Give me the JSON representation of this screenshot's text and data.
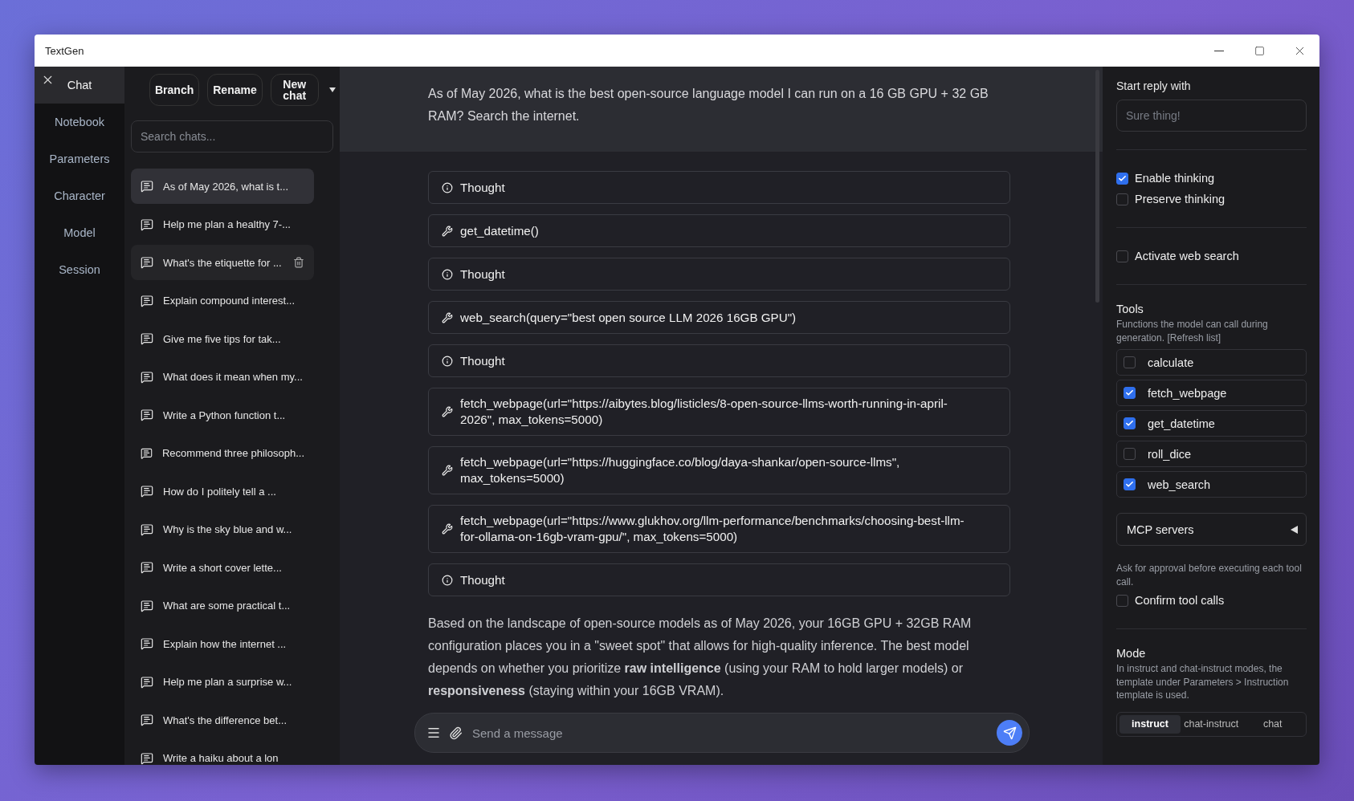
{
  "window": {
    "title": "TextGen"
  },
  "nav": {
    "items": [
      {
        "label": "Chat",
        "selected": true
      },
      {
        "label": "Notebook",
        "selected": false
      },
      {
        "label": "Parameters",
        "selected": false
      },
      {
        "label": "Character",
        "selected": false
      },
      {
        "label": "Model",
        "selected": false
      },
      {
        "label": "Session",
        "selected": false
      }
    ]
  },
  "chat_list": {
    "buttons": [
      "Branch",
      "Rename",
      "New chat"
    ],
    "search": {
      "placeholder": "Search chats..."
    },
    "items": [
      {
        "title": "As of May 2026, what is t...",
        "selected": true,
        "hovered": false
      },
      {
        "title": "Help me plan a healthy 7-...",
        "selected": false,
        "hovered": false
      },
      {
        "title": "What's the etiquette for ...",
        "selected": false,
        "hovered": true
      },
      {
        "title": "Explain compound interest...",
        "selected": false,
        "hovered": false
      },
      {
        "title": "Give me five tips for tak...",
        "selected": false,
        "hovered": false
      },
      {
        "title": "What does it mean when my...",
        "selected": false,
        "hovered": false
      },
      {
        "title": "Write a Python function t...",
        "selected": false,
        "hovered": false
      },
      {
        "title": "Recommend three philosoph...",
        "selected": false,
        "hovered": false
      },
      {
        "title": "How do I politely tell a ...",
        "selected": false,
        "hovered": false
      },
      {
        "title": "Why is the sky blue and w...",
        "selected": false,
        "hovered": false
      },
      {
        "title": "Write a short cover lette...",
        "selected": false,
        "hovered": false
      },
      {
        "title": "What are some practical t...",
        "selected": false,
        "hovered": false
      },
      {
        "title": "Explain how the internet ...",
        "selected": false,
        "hovered": false
      },
      {
        "title": "Help me plan a surprise w...",
        "selected": false,
        "hovered": false
      },
      {
        "title": "What's the difference bet...",
        "selected": false,
        "hovered": false
      },
      {
        "title": "Write a haiku about a lon",
        "selected": false,
        "hovered": false
      }
    ]
  },
  "conversation": {
    "user_message": "As of May 2026, what is the best open-source language model I can run on a 16 GB GPU + 32 GB RAM? Search the internet.",
    "steps": [
      {
        "kind": "thought",
        "text": "Thought"
      },
      {
        "kind": "tool",
        "text": "get_datetime()"
      },
      {
        "kind": "thought",
        "text": "Thought"
      },
      {
        "kind": "tool",
        "text": "web_search(query=\"best open source LLM 2026 16GB GPU\")"
      },
      {
        "kind": "thought",
        "text": "Thought"
      },
      {
        "kind": "tool",
        "text": "fetch_webpage(url=\"https://aibytes.blog/listicles/8-open-source-llms-worth-running-in-april-2026\", max_tokens=5000)"
      },
      {
        "kind": "tool",
        "text": "fetch_webpage(url=\"https://huggingface.co/blog/daya-shankar/open-source-llms\", max_tokens=5000)"
      },
      {
        "kind": "tool",
        "text": "fetch_webpage(url=\"https://www.glukhov.org/llm-performance/benchmarks/choosing-best-llm-for-ollama-on-16gb-vram-gpu/\", max_tokens=5000)"
      },
      {
        "kind": "thought",
        "text": "Thought"
      }
    ],
    "answer": "Based on the landscape of open-source models as of May 2026, your 16GB GPU + 32GB RAM configuration places you in a \"sweet spot\" that allows for high-quality inference. The best model depends on whether you prioritize **raw intelligence** (using your RAM to hold larger models) or **responsiveness** (staying within your 16GB VRAM).",
    "composer": {
      "placeholder": "Send a message"
    }
  },
  "settings": {
    "start_reply": {
      "label": "Start reply with",
      "placeholder": "Sure thing!"
    },
    "thinking": [
      {
        "label": "Enable thinking",
        "checked": true
      },
      {
        "label": "Preserve thinking",
        "checked": false
      }
    ],
    "web_search": {
      "label": "Activate web search",
      "checked": false
    },
    "tools": {
      "title": "Tools",
      "description": "Functions the model can call during generation. [Refresh list]",
      "items": [
        {
          "name": "calculate",
          "checked": false
        },
        {
          "name": "fetch_webpage",
          "checked": true
        },
        {
          "name": "get_datetime",
          "checked": true
        },
        {
          "name": "roll_dice",
          "checked": false
        },
        {
          "name": "web_search",
          "checked": true
        }
      ]
    },
    "mcp": {
      "label": "MCP servers",
      "expanded": false
    },
    "confirm": {
      "description": "Ask for approval before executing each tool call.",
      "label": "Confirm tool calls",
      "checked": false
    },
    "mode": {
      "title": "Mode",
      "description": "In instruct and chat-instruct modes, the template under Parameters > Instruction template is used.",
      "options": [
        {
          "label": "instruct",
          "selected": true
        },
        {
          "label": "chat-instruct",
          "selected": false
        },
        {
          "label": "chat",
          "selected": false
        }
      ]
    }
  }
}
